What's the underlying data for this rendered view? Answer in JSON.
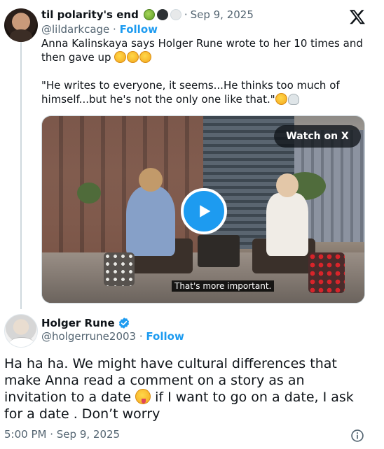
{
  "quoted_tweet": {
    "author_name": "til polarity's end",
    "separator": "·",
    "date": "Sep 9, 2025",
    "handle": "@lildarkcage",
    "follow_label": "Follow",
    "text_line1": "Anna Kalinskaya says Holger Rune wrote to her 10 times and then gave up ",
    "text_line2": "\"He writes to everyone, it seems...He thinks too much of himself...but he's not the only one like that.\"",
    "video": {
      "watch_label": "Watch on X",
      "caption": "That's more important."
    }
  },
  "reply_tweet": {
    "author_name": "Holger Rune",
    "handle": "@holgerrune2003",
    "separator": "·",
    "follow_label": "Follow",
    "text_part1": "Ha ha ha. We might have cultural differences that make Anna read a comment on a story as an invitation to a date ",
    "text_part2": " if I want to go on a date, I ask for a date . Don’t worry",
    "time": "5:00 PM",
    "date": "Sep 9, 2025"
  },
  "icons": {
    "brand": "x-logo-icon",
    "verified": "verified-badge-icon",
    "info": "info-icon",
    "play": "play-icon"
  },
  "colors": {
    "link": "#1d9bf0",
    "muted": "#536471",
    "text": "#0f1419"
  }
}
